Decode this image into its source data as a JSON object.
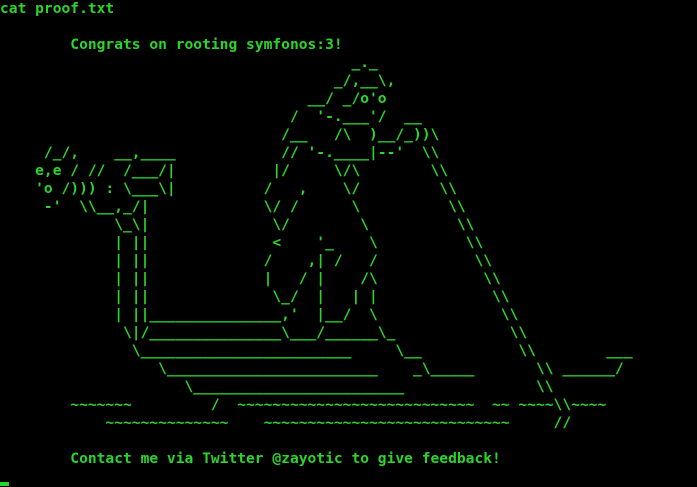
{
  "terminal": {
    "command": "cat proof.txt",
    "congrats": "        Congrats on rooting symfonos:3!",
    "ascii_art": "                                        _._\n                                      _/,__\\,\n                                   __/ _/o'o\n                                 /  '-.___'/  __\n                                /__   /\\  )__/_))\\\n     /_/,    __,____            // '-.____|--'  \\\\\n    e,e / //  /___/|           |/     \\/\\        \\\\\n    'o /))) : \\___\\|          /   ,    \\/         \\\\\n     -'  \\\\__,_/|             \\/ /      \\          \\\\\n             \\_\\|              \\/        \\          \\\\\n             | ||              <    '_    \\          \\\\\n             | ||             /    ,| /   /           \\\\\n             | ||             |   / |    /\\            \\\\\n             | ||              \\_/  |   | |             \\\\\n             | ||_______________,'  |__/  \\              \\\\\n              \\|/_______________\\___/______\\_             \\\\\n               \\________________________     \\__           \\\\        ___\n                  \\________________________    _\\_____       \\\\ ______/\n                     \\________________________               \\\\\n        ~~~~~~~         /  ~~~~~~~~~~~~~~~~~~~~~~~~~~~  ~~ ~~~~\\\\~~~~\n            ~~~~~~~~~~~~~~    ~~~~~~~~~~~~~~~~~~~~~~~~~~~~     //",
    "feedback": "        Contact me via Twitter @zayotic to give feedback!",
    "text_color": "#2bd62b",
    "background_color": "#000000"
  }
}
